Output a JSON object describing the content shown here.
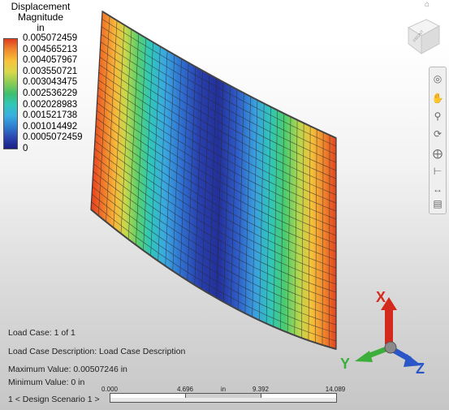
{
  "legend": {
    "title_line1": "Displacement",
    "title_line2": "Magnitude",
    "unit": "in",
    "labels": [
      "0.005072459",
      "0.004565213",
      "0.004057967",
      "0.003550721",
      "0.003043475",
      "0.002536229",
      "0.002028983",
      "0.001521738",
      "0.001014492",
      "0.0005072459",
      "0"
    ],
    "colors": [
      "#e03b1f",
      "#f08a2e",
      "#f7c23c",
      "#d9d84a",
      "#8ccc55",
      "#3dbf6e",
      "#30c7b8",
      "#3aaee0",
      "#2e7fd0",
      "#2a45b0",
      "#1a1f86"
    ]
  },
  "info": {
    "load_case": "Load Case:  1 of 1",
    "load_case_description": "Load Case Description:  Load Case Description",
    "maximum_value": "Maximum Value: 0.00507246 in",
    "minimum_value": "Minimum Value: 0 in",
    "design_scenario": "1 < Design Scenario 1 >"
  },
  "scale_bar": {
    "ticks": [
      "0.000",
      "4.696",
      "in",
      "9.392",
      "14.089"
    ]
  },
  "triad": {
    "x_label": "X",
    "y_label": "Y",
    "z_label": "Z",
    "x_color": "#d42a1e",
    "y_color": "#3cae3c",
    "z_color": "#2a56c8"
  },
  "viewcube": {
    "face_label": "FRONT"
  },
  "navbar": {
    "icons": [
      "steering-wheel-icon",
      "pan-icon",
      "zoom-icon",
      "orbit-icon",
      "center-icon",
      "look-icon",
      "walk-icon",
      "rewind-icon"
    ]
  }
}
